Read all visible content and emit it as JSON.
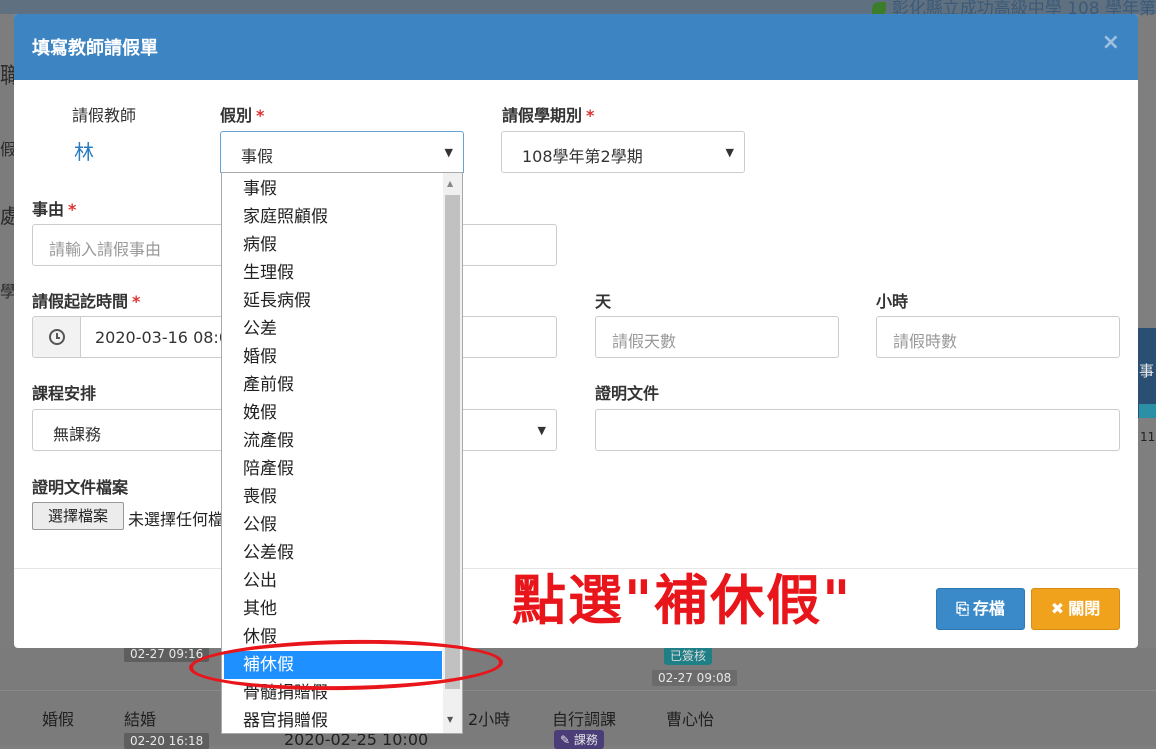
{
  "background": {
    "school_name": "彰化縣立成功高級中學 108 學年第",
    "left_fragments": [
      "職",
      "假",
      "處",
      "學"
    ],
    "right_header": "事",
    "right_badge": "已",
    "right_stamp": "11",
    "row1": {
      "stamp_left": "02-27 09:16",
      "badge": "已簽核",
      "stamp_right": "02-27 09:08"
    },
    "row2": {
      "type": "婚假",
      "reason": "結婚",
      "stamp": "02-20 16:18",
      "start": "2020-02-25 10:00",
      "hours": "2小時",
      "course": "自行調課",
      "badge": "課務",
      "name": "曹心怡"
    }
  },
  "modal": {
    "title": "填寫教師請假單",
    "close_glyph": "×",
    "teacher_label": "請假教師",
    "teacher_value": "林",
    "leave_type_label": "假別",
    "leave_type_value": "事假",
    "semester_label": "請假學期別",
    "semester_value": "108學年第2學期",
    "reason_label": "事由",
    "reason_placeholder": "請輸入請假事由",
    "period_label": "請假起訖時間",
    "period_value": "2020-03-16 08:0",
    "days_label": "天",
    "days_placeholder": "請假天數",
    "hours_label": "小時",
    "hours_placeholder": "請假時數",
    "course_label": "課程安排",
    "course_value": "無課務",
    "proof_label": "證明文件",
    "proof_file_label": "證明文件檔案",
    "file_button": "選擇檔案",
    "file_status": "未選擇任何檔",
    "required_mark": "*",
    "save_button": "存檔",
    "close_button": "關閉"
  },
  "dropdown": {
    "options": [
      "事假",
      "家庭照顧假",
      "病假",
      "生理假",
      "延長病假",
      "公差",
      "婚假",
      "產前假",
      "娩假",
      "流產假",
      "陪產假",
      "喪假",
      "公假",
      "公差假",
      "公出",
      "其他",
      "休假",
      "補休假",
      "骨髓捐贈假",
      "器官捐贈假"
    ],
    "highlighted": "補休假"
  },
  "annotation": {
    "text": "點選\"補休假\"",
    "color": "#e8161b"
  },
  "colors": {
    "header": "#3d84c2",
    "save": "#3a8ac9",
    "close": "#f0a21d",
    "highlight": "#1e90ff"
  }
}
